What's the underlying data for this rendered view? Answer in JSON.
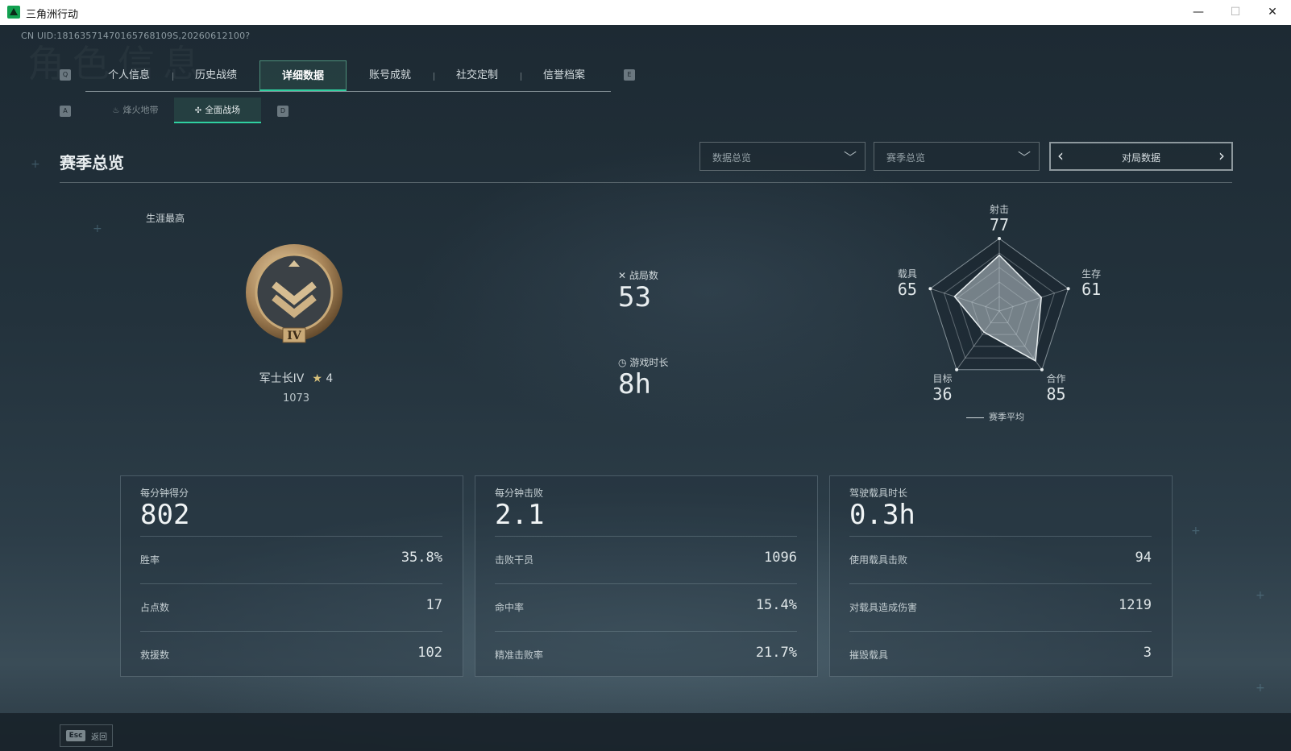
{
  "window": {
    "title": "三角洲行动",
    "minimize": "—",
    "maximize": "☐",
    "close": "✕"
  },
  "uid": "CN UID:18163571470165768109S,20260612100?",
  "bg_watermark": "角色信息",
  "tabs": {
    "prev_key": "Q",
    "next_key": "E",
    "items": [
      {
        "label": "个人信息"
      },
      {
        "label": "历史战绩"
      },
      {
        "label": "详细数据",
        "active": true
      },
      {
        "label": "账号成就"
      },
      {
        "label": "社交定制"
      },
      {
        "label": "信誉档案"
      }
    ]
  },
  "subtabs": {
    "prev_key": "A",
    "next_key": "D",
    "items": [
      {
        "label": "烽火地带",
        "icon": "flame-icon"
      },
      {
        "label": "全面战场",
        "icon": "crosshair-icon",
        "active": true
      }
    ]
  },
  "section": {
    "title": "赛季总览",
    "dropdown1": "数据总览",
    "dropdown2": "赛季总览",
    "switcher": "对局数据"
  },
  "career": {
    "label": "生涯最高",
    "rank_name": "军士长IV",
    "rank_tier": "IV",
    "stars": "4",
    "score": "1073"
  },
  "summary": {
    "matches_label": "战局数",
    "matches_value": "53",
    "playtime_label": "游戏时长",
    "playtime_value": "8h"
  },
  "radar": {
    "axes": [
      {
        "label": "射击",
        "value": "77",
        "score": 77
      },
      {
        "label": "生存",
        "value": "61",
        "score": 61
      },
      {
        "label": "合作",
        "value": "85",
        "score": 85
      },
      {
        "label": "目标",
        "value": "36",
        "score": 36
      },
      {
        "label": "载具",
        "value": "65",
        "score": 65
      }
    ],
    "legend": "赛季平均"
  },
  "cards": [
    {
      "title": "每分钟得分",
      "value": "802",
      "rows": [
        {
          "label": "胜率",
          "value": "35.8%"
        },
        {
          "label": "占点数",
          "value": "17"
        },
        {
          "label": "救援数",
          "value": "102"
        }
      ]
    },
    {
      "title": "每分钟击败",
      "value": "2.1",
      "rows": [
        {
          "label": "击败干员",
          "value": "1096"
        },
        {
          "label": "命中率",
          "value": "15.4%"
        },
        {
          "label": "精准击败率",
          "value": "21.7%"
        }
      ]
    },
    {
      "title": "驾驶载具时长",
      "value": "0.3h",
      "rows": [
        {
          "label": "使用载具击败",
          "value": "94"
        },
        {
          "label": "对载具造成伤害",
          "value": "1219"
        },
        {
          "label": "摧毁载具",
          "value": "3"
        }
      ]
    }
  ],
  "footer": {
    "esc_key": "Esc",
    "back_label": "返回"
  }
}
